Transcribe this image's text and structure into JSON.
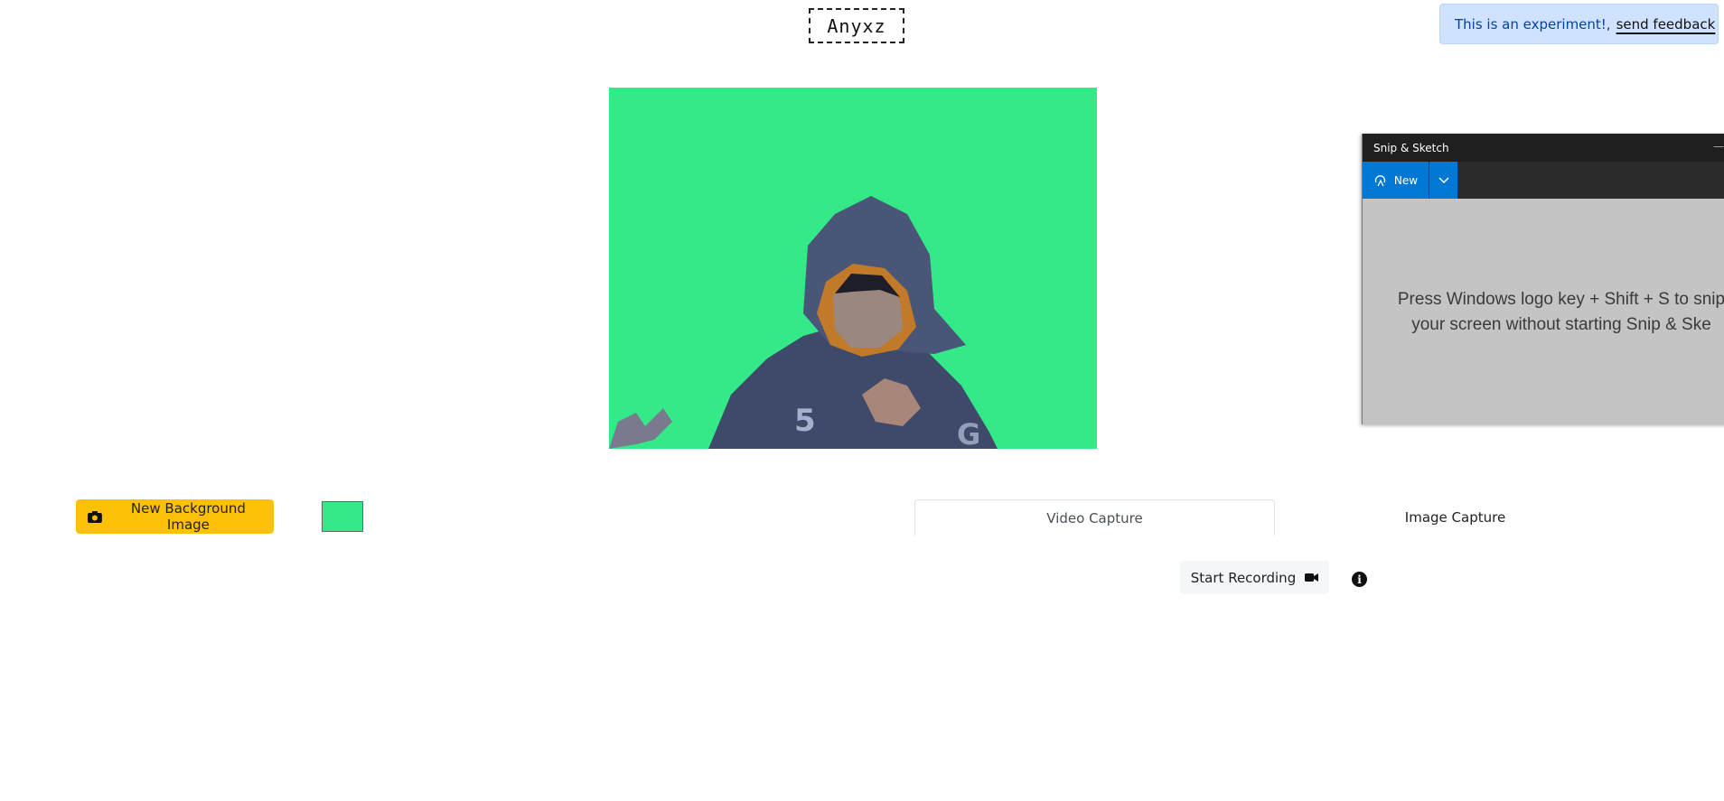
{
  "logo": {
    "text": "Anyxz"
  },
  "banner": {
    "message": "This is an experiment!,",
    "link_label": "send feedback",
    "color": "#cfe2ff"
  },
  "canvas": {
    "background_color": "#34ea88"
  },
  "controls": {
    "background_button_label": "New Background Image",
    "background_button_icon": "image-icon",
    "swatch_color": "#34ea88"
  },
  "tabs": [
    {
      "label": "Video Capture",
      "active": true
    },
    {
      "label": "Image Capture",
      "active": false
    }
  ],
  "recording": {
    "start_label": "Start Recording",
    "icon": "video-camera-icon",
    "info_glyph": "i"
  },
  "snip_window": {
    "title": "Snip & Sketch",
    "new_label": "New",
    "message_line1": "Press Windows logo key + Shift + S to snip",
    "message_line2": "your screen without starting Snip & Ske",
    "accent": "#0078d4"
  }
}
